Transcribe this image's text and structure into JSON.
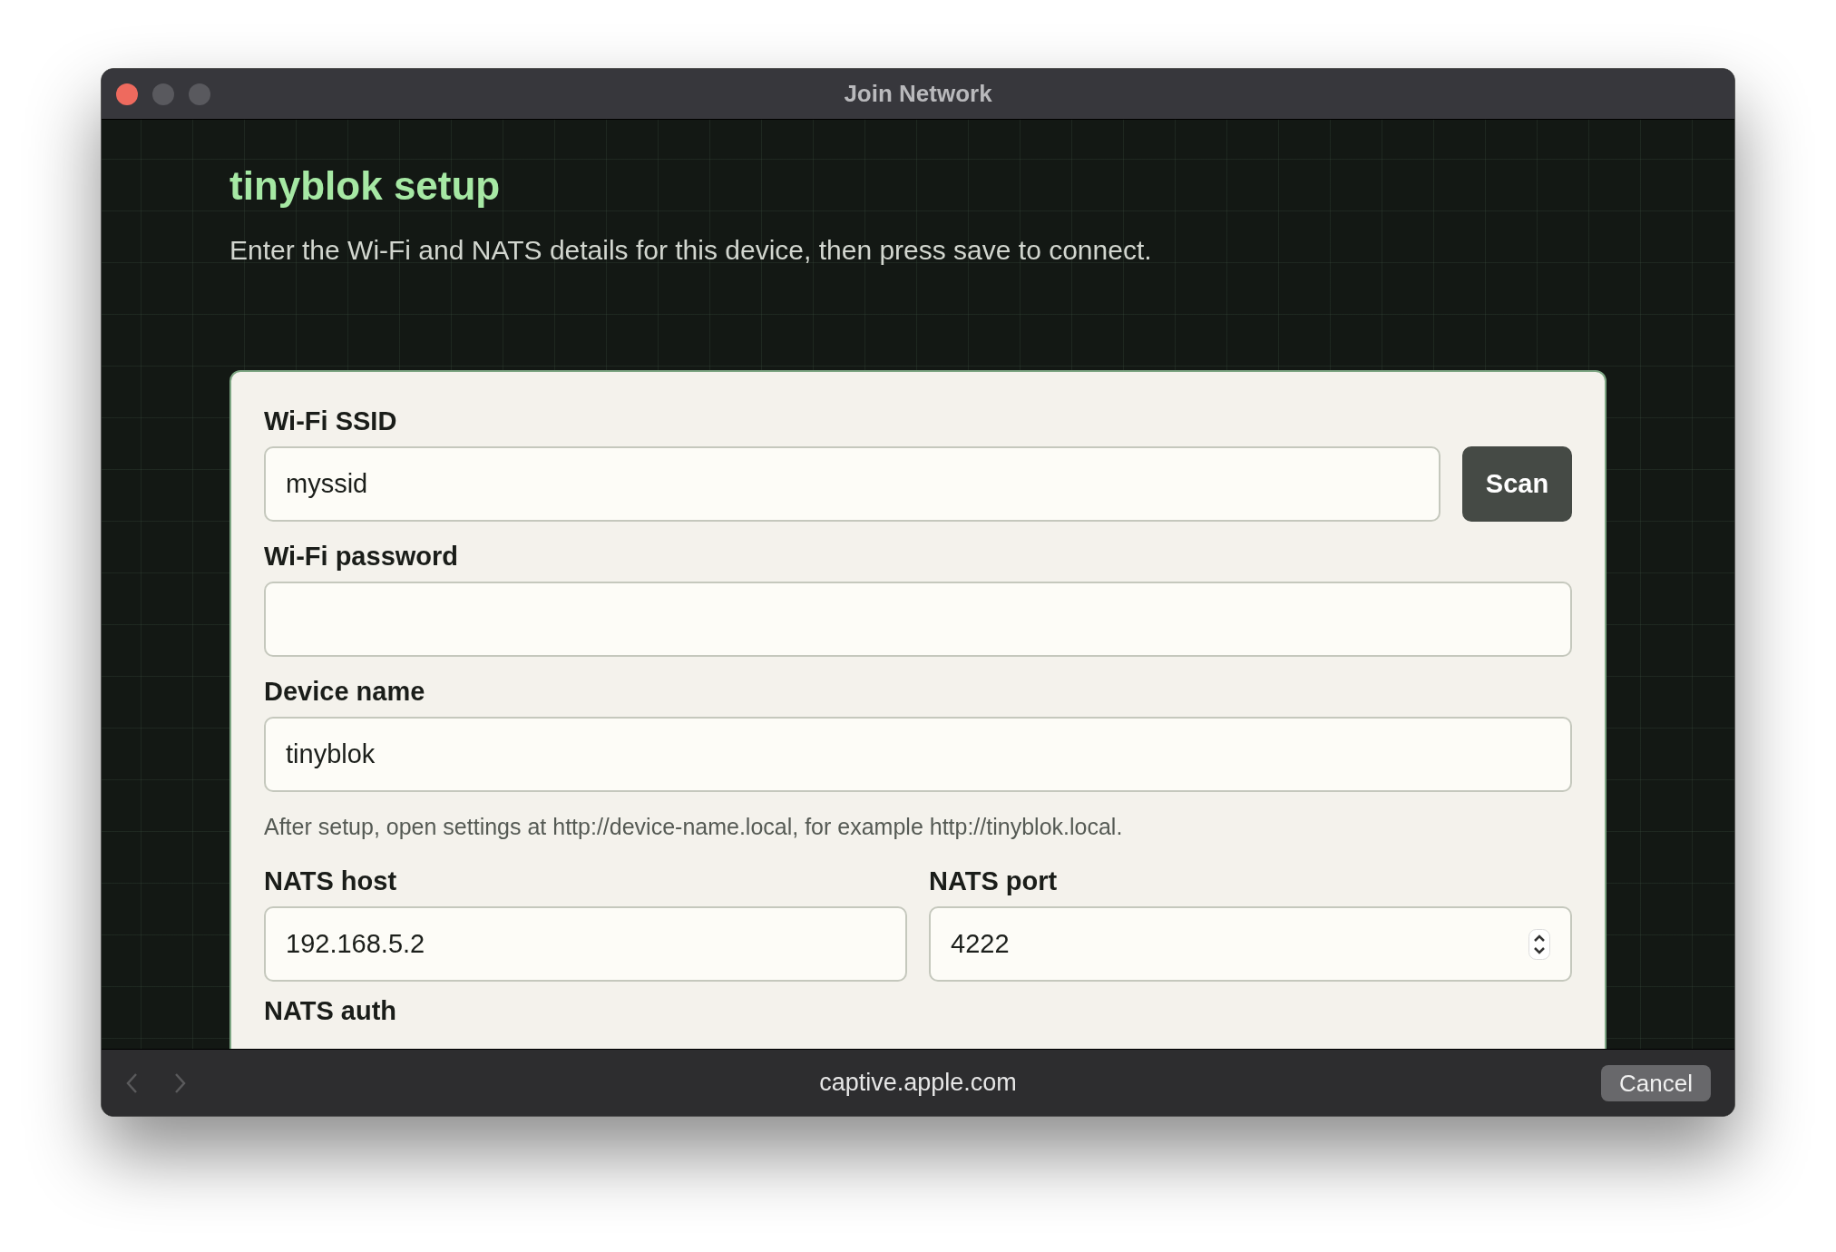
{
  "window": {
    "title": "Join Network"
  },
  "page": {
    "title": "tinyblok setup",
    "subtitle": "Enter the Wi-Fi and NATS details for this device, then press save to connect."
  },
  "form": {
    "ssid": {
      "label": "Wi-Fi SSID",
      "value": "myssid",
      "button": "Scan"
    },
    "password": {
      "label": "Wi-Fi password"
    },
    "device_name": {
      "label": "Device name",
      "value": "tinyblok"
    },
    "hint": "After setup, open settings at http://device-name.local, for example http://tinyblok.local.",
    "nats_host": {
      "label": "NATS host",
      "value": "192.168.5.2"
    },
    "nats_port": {
      "label": "NATS port",
      "value": "4222"
    },
    "nats_auth": {
      "label": "NATS auth"
    }
  },
  "bottom_bar": {
    "url": "captive.apple.com",
    "cancel": "Cancel"
  }
}
